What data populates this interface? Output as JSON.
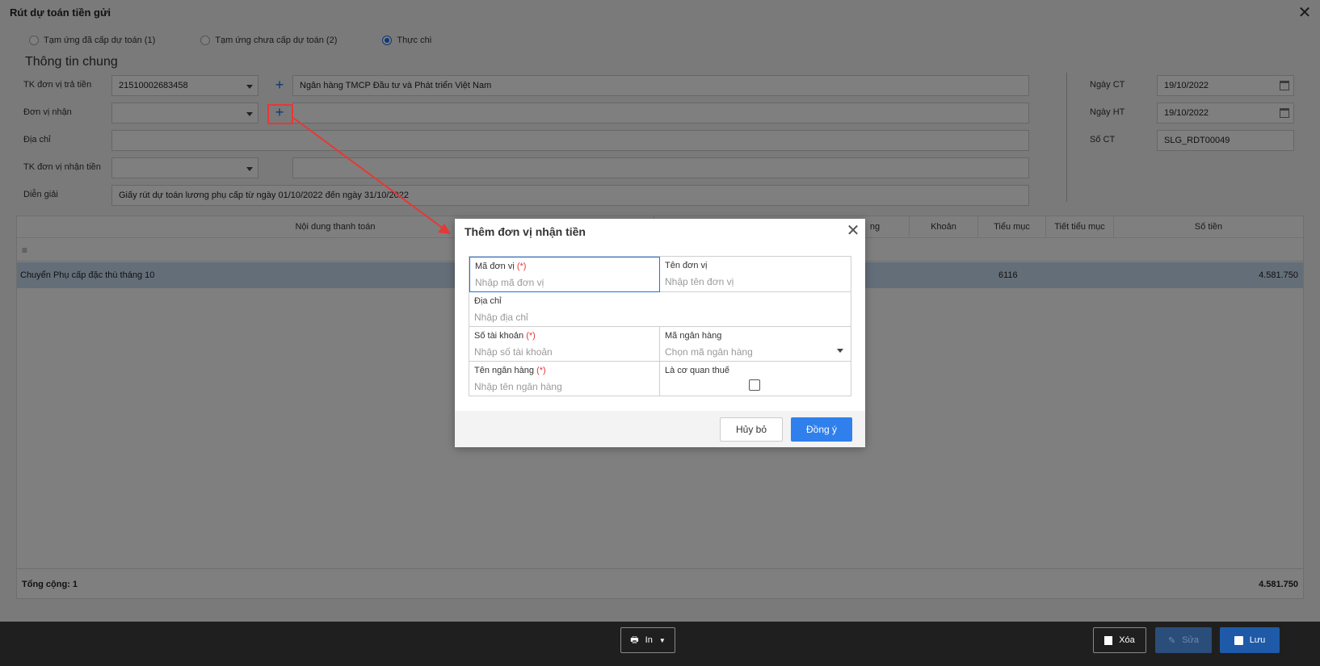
{
  "window": {
    "title": "Rút dự toán tiền gửi"
  },
  "options": {
    "radio1": "Tạm ứng đã cấp dự toán (1)",
    "radio2": "Tạm ứng chưa cấp dự toán (2)",
    "radio3": "Thực chi",
    "selected": "radio3"
  },
  "general": {
    "section_title": "Thông tin chung",
    "tk_tra_tien_label": "TK đơn vị trả tiền",
    "tk_tra_tien_value": "21510002683458",
    "bank_name": "Ngân hàng TMCP Đầu tư và Phát triển Việt Nam",
    "don_vi_nhan_label": "Đơn vị nhận",
    "dia_chi_label": "Địa chỉ",
    "tk_nhan_tien_label": "TK đơn vị nhận tiền",
    "dien_giai_label": "Diễn giải",
    "dien_giai_value": "Giấy rút dự toán lương phụ cấp từ ngày 01/10/2022 đến ngày 31/10/2022",
    "ngay_ct_label": "Ngày CT",
    "ngay_ct_value": "19/10/2022",
    "ngay_ht_label": "Ngày HT",
    "ngay_ht_value": "19/10/2022",
    "so_ct_label": "Số CT",
    "so_ct_value": "SLG_RDT00049"
  },
  "table": {
    "headers": {
      "noi_dung": "Nội dung thanh toán",
      "khoan": "Khoản",
      "tieu_muc": "Tiểu mục",
      "tiet_tieu_muc": "Tiết tiểu mục",
      "so_tien": "Số tiền",
      "partial": "ng"
    },
    "row": {
      "noi_dung": "Chuyển Phụ cấp đặc thù tháng 10",
      "tieu_muc": "6116",
      "so_tien": "4.581.750"
    },
    "total_label": "Tổng cộng: 1",
    "total_value": "4.581.750"
  },
  "footer": {
    "print_label": "In",
    "delete_label": "Xóa",
    "edit_label": "Sửa",
    "save_label": "Lưu"
  },
  "dialog": {
    "title": "Thêm đơn vị nhận tiền",
    "ma_don_vi_label": "Mã đơn vị",
    "ma_don_vi_placeholder": "Nhập mã đơn vị",
    "ten_don_vi_label": "Tên đơn vị",
    "ten_don_vi_placeholder": "Nhập tên đơn vị",
    "dia_chi_label": "Địa chỉ",
    "dia_chi_placeholder": "Nhập địa chỉ",
    "so_tai_khoan_label": "Số tài khoản",
    "so_tai_khoan_placeholder": "Nhập số tài khoản",
    "ma_ngan_hang_label": "Mã ngân hàng",
    "ma_ngan_hang_placeholder": "Chọn mã ngân hàng",
    "ten_ngan_hang_label": "Tên ngân hàng",
    "ten_ngan_hang_placeholder": "Nhập tên ngân hàng",
    "co_quan_thue_label": "Là cơ quan thuế",
    "required_mark": "(*)",
    "cancel_label": "Hủy bỏ",
    "ok_label": "Đồng ý"
  },
  "colors": {
    "accent": "#2f80ed",
    "annotation": "#e53935",
    "selected_row": "#c9dcf3"
  }
}
